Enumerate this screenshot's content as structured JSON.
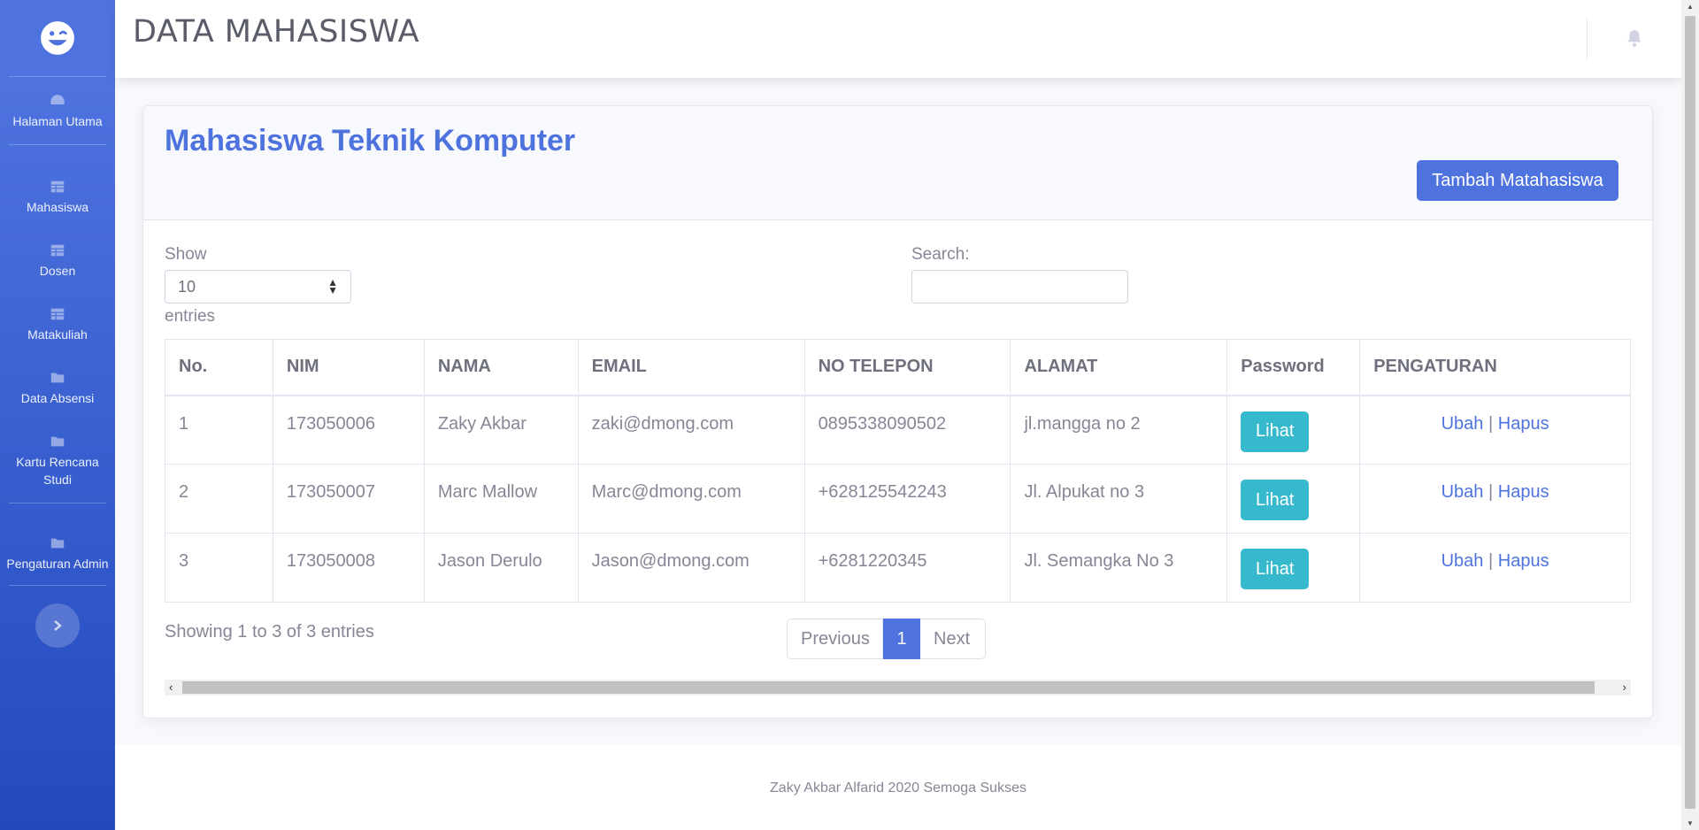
{
  "header": {
    "title": "DATA MAHASISWA"
  },
  "sidebar": {
    "items": [
      {
        "label": "Halaman Utama",
        "icon": "tachometer-icon"
      },
      {
        "label": "Mahasiswa",
        "icon": "table-icon"
      },
      {
        "label": "Dosen",
        "icon": "table-icon"
      },
      {
        "label": "Matakuliah",
        "icon": "table-icon"
      },
      {
        "label": "Data Absensi",
        "icon": "folder-icon"
      },
      {
        "label": "Kartu Rencana Studi",
        "icon": "folder-icon"
      },
      {
        "label": "Pengaturan Admin",
        "icon": "folder-icon"
      }
    ]
  },
  "card": {
    "title": "Mahasiswa Teknik Komputer",
    "add_button": "Tambah Matahasiswa",
    "show_label": "Show",
    "entries_label": "entries",
    "entries_value": "10",
    "search_label": "Search:",
    "search_value": ""
  },
  "table": {
    "columns": [
      "No.",
      "NIM",
      "NAMA",
      "EMAIL",
      "NO TELEPON",
      "ALAMAT",
      "Password",
      "PENGATURAN"
    ],
    "rows": [
      {
        "no": "1",
        "nim": "173050006",
        "nama": "Zaky Akbar",
        "email": "zaki@dmong.com",
        "telepon": "0895338090502",
        "alamat": "jl.mangga no 2",
        "password_button": "Lihat",
        "edit": "Ubah",
        "sep": "|",
        "delete": "Hapus"
      },
      {
        "no": "2",
        "nim": "173050007",
        "nama": "Marc Mallow",
        "email": "Marc@dmong.com",
        "telepon": "+628125542243",
        "alamat": "Jl. Alpukat no 3",
        "password_button": "Lihat",
        "edit": "Ubah",
        "sep": "|",
        "delete": "Hapus"
      },
      {
        "no": "3",
        "nim": "173050008",
        "nama": "Jason Derulo",
        "email": "Jason@dmong.com",
        "telepon": "+6281220345",
        "alamat": "Jl. Semangka No 3",
        "password_button": "Lihat",
        "edit": "Ubah",
        "sep": "|",
        "delete": "Hapus"
      }
    ]
  },
  "pagination": {
    "info": "Showing 1 to 3 of 3 entries",
    "previous": "Previous",
    "current": "1",
    "next": "Next"
  },
  "footer": {
    "text": "Zaky Akbar Alfarid 2020 Semoga Sukses"
  },
  "colors": {
    "primary": "#4e73df",
    "info": "#36b9cc",
    "text": "#858796"
  }
}
